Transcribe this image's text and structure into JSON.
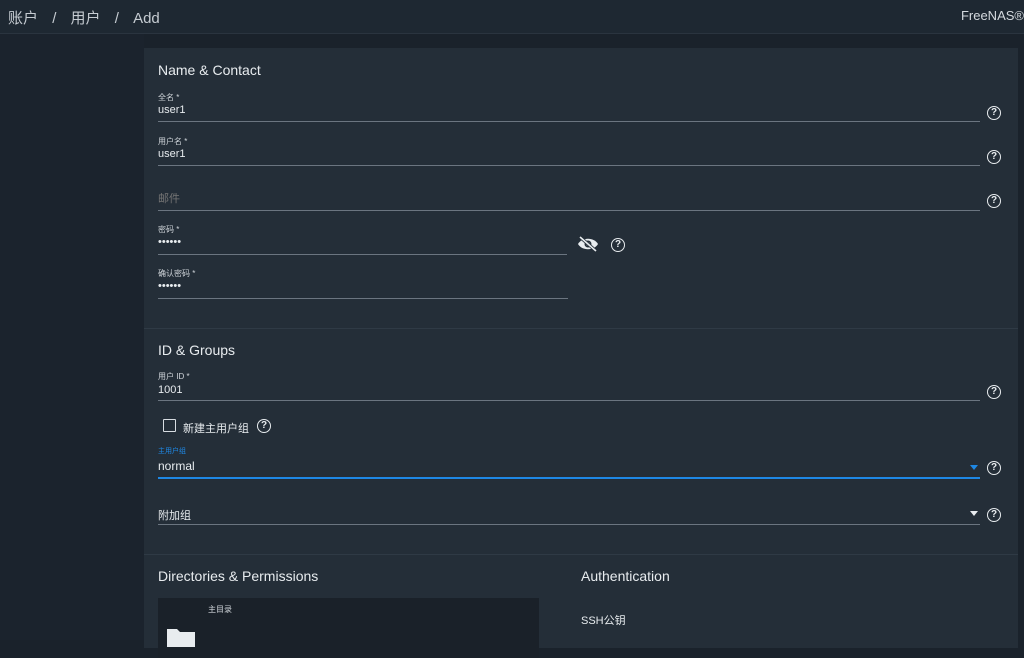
{
  "breadcrumb": {
    "part1": "账户",
    "sep1": "/",
    "part2": "用户",
    "sep2": "/",
    "part3": "Add"
  },
  "brand": "FreeNAS®",
  "sections": {
    "name_contact": "Name & Contact",
    "id_groups": "ID & Groups",
    "dirs_perms": "Directories & Permissions",
    "authentication": "Authentication"
  },
  "fields": {
    "full_name": {
      "label": "全名 *",
      "value": "user1"
    },
    "username": {
      "label": "用户名 *",
      "value": "user1"
    },
    "email": {
      "label": "",
      "value": "邮件"
    },
    "password": {
      "label": "密码 *",
      "value": "••••••"
    },
    "confirm_password": {
      "label": "确认密码 *",
      "value": "••••••"
    },
    "user_id": {
      "label": "用户 ID *",
      "value": "1001"
    },
    "new_primary_group": {
      "label": "新建主用户组",
      "checked": false
    },
    "primary_group": {
      "label": "主用户组",
      "value": "normal"
    },
    "aux_groups": {
      "value": "附加组"
    },
    "home_dir": {
      "label": "主目录"
    },
    "ssh_key": {
      "value": "SSH公钥"
    }
  },
  "colors": {
    "accent": "#1e88e5",
    "background": "#1a222b",
    "card": "#242e38"
  },
  "icons": {
    "help": "help-circle-icon",
    "eye": "eye-off-icon",
    "folder": "folder-icon",
    "caret": "caret-down-icon"
  }
}
